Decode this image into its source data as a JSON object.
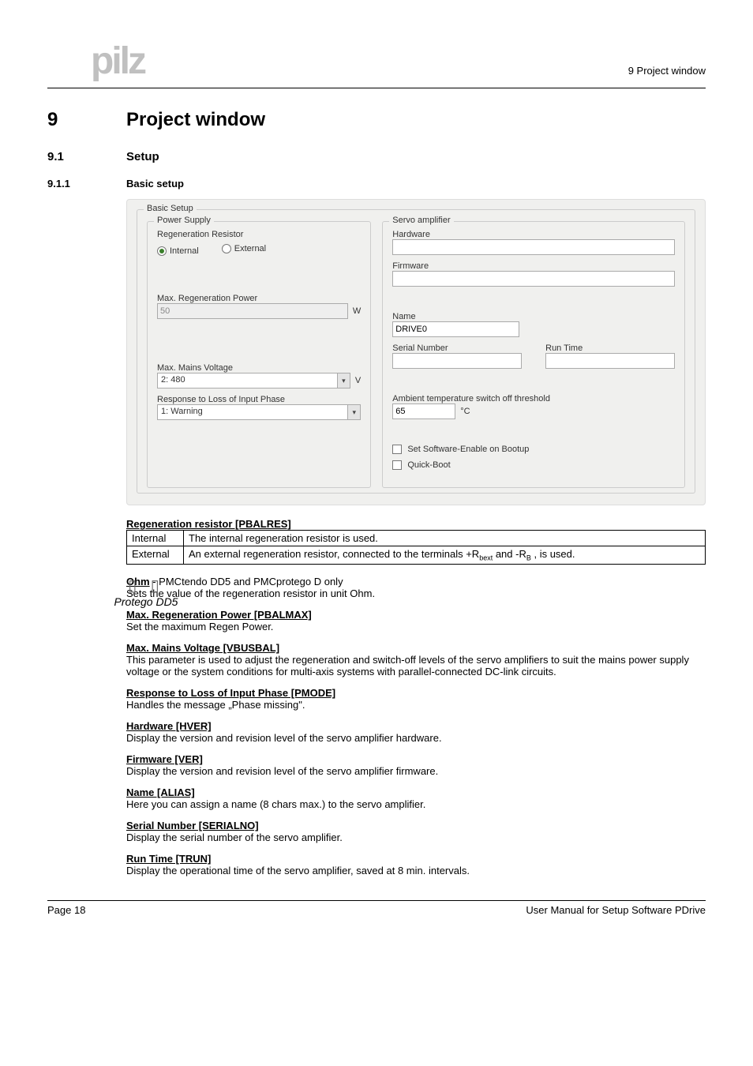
{
  "header": {
    "logo": "pilz",
    "breadcrumb": "9  Project window"
  },
  "sections": {
    "s9_num": "9",
    "s9_title": "Project window",
    "s91_num": "9.1",
    "s91_title": "Setup",
    "s911_num": "9.1.1",
    "s911_title": "Basic setup"
  },
  "ui": {
    "root_legend": "Basic Setup",
    "ps_legend": "Power Supply",
    "sa_legend": "Servo amplifier",
    "regen_label": "Regeneration Resistor",
    "radio_internal": "Internal",
    "radio_external": "External",
    "max_regen_power_label": "Max. Regeneration Power",
    "max_regen_power_value": "50",
    "unit_w": "W",
    "max_mains_label": "Max. Mains Voltage",
    "max_mains_value": "2: 480",
    "unit_v": "V",
    "resp_loss_label": "Response to Loss of Input Phase",
    "resp_loss_value": "1: Warning",
    "hardware_label": "Hardware",
    "firmware_label": "Firmware",
    "name_label": "Name",
    "name_value": "DRIVE0",
    "serial_label": "Serial Number",
    "runtime_label": "Run Time",
    "ambient_label": "Ambient temperature switch off threshold",
    "ambient_value": "65",
    "unit_c": "°C",
    "chk_sw_enable": "Set Software-Enable on Bootup",
    "chk_quick_boot": "Quick-Boot"
  },
  "regen_table": {
    "heading": "Regeneration resistor [PBALRES]",
    "r1c1": "Internal",
    "r1c2": "The internal regeneration resistor is used.",
    "r2c1": "External",
    "r2c2_pre": "An external regeneration resistor, connected to the terminals +R",
    "r2c2_sub1": "bext",
    "r2c2_mid": " and -R",
    "r2c2_sub2": "B",
    "r2c2_post": " , is used."
  },
  "inline_logo": {
    "line2": "Protego  DD5"
  },
  "params": {
    "ohm_head": "Ohm",
    "ohm_tail": " - PMCtendo DD5 and PMCprotego D only",
    "ohm_text": "Sets the value of the regeneration resistor in unit Ohm.",
    "maxregen_head": "Max. Regeneration Power [PBALMAX]",
    "maxregen_text": "Set the maximum Regen Power.",
    "mains_head": "Max. Mains Voltage [VBUSBAL]",
    "mains_text": "This parameter is used to adjust the regeneration and switch-off levels of the servo amplifiers to suit the mains power supply voltage or the system conditions for multi-axis systems with parallel-connected DC-link circuits.",
    "pmode_head": "Response to Loss of Input Phase [PMODE]",
    "pmode_text": "Handles the message „Phase missing\".",
    "hver_head": "Hardware [HVER]",
    "hver_text": "Display the version and revision level of the servo amplifier hardware.",
    "ver_head": "Firmware [VER]",
    "ver_text": "Display the version and revision level of the servo amplifier firmware.",
    "alias_head": "Name [ALIAS]",
    "alias_text": "Here you can assign a name (8 chars max.) to the servo amplifier.",
    "serial_head": "Serial Number [SERIALNO]",
    "serial_text": "Display the serial number of the servo amplifier.",
    "trun_head": "Run Time [TRUN]",
    "trun_text": "Display the operational time of the servo amplifier, saved at 8 min. intervals."
  },
  "footer": {
    "left": "Page 18",
    "right": "User Manual for Setup Software PDrive"
  }
}
